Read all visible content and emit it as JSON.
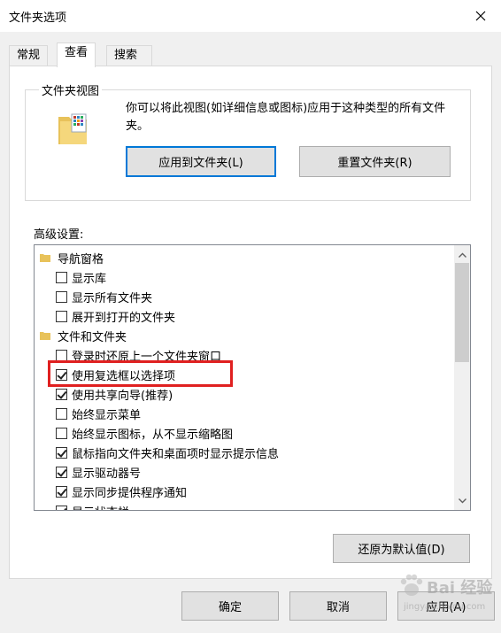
{
  "window": {
    "title": "文件夹选项",
    "close_icon": "close-icon"
  },
  "tabs": [
    {
      "label": "常规",
      "active": false
    },
    {
      "label": "查看",
      "active": true
    },
    {
      "label": "搜索",
      "active": false
    }
  ],
  "folder_views": {
    "legend": "文件夹视图",
    "description": "你可以将此视图(如详细信息或图标)应用于这种类型的所有文件夹。",
    "apply_button": "应用到文件夹(L)",
    "reset_button": "重置文件夹(R)"
  },
  "advanced": {
    "label": "高级设置:",
    "items": [
      {
        "type": "folder",
        "label": "导航窗格"
      },
      {
        "type": "checkbox",
        "label": "显示库",
        "checked": false
      },
      {
        "type": "checkbox",
        "label": "显示所有文件夹",
        "checked": false
      },
      {
        "type": "checkbox",
        "label": "展开到打开的文件夹",
        "checked": false
      },
      {
        "type": "folder",
        "label": "文件和文件夹"
      },
      {
        "type": "checkbox",
        "label": "登录时还原上一个文件夹窗口",
        "checked": false
      },
      {
        "type": "checkbox",
        "label": "使用复选框以选择项",
        "checked": true
      },
      {
        "type": "checkbox",
        "label": "使用共享向导(推荐)",
        "checked": true
      },
      {
        "type": "checkbox",
        "label": "始终显示菜单",
        "checked": false
      },
      {
        "type": "checkbox",
        "label": "始终显示图标，从不显示缩略图",
        "checked": false
      },
      {
        "type": "checkbox",
        "label": "鼠标指向文件夹和桌面项时显示提示信息",
        "checked": true
      },
      {
        "type": "checkbox",
        "label": "显示驱动器号",
        "checked": true
      },
      {
        "type": "checkbox",
        "label": "显示同步提供程序通知",
        "checked": true
      },
      {
        "type": "checkbox",
        "label": "显示状态栏",
        "checked": true
      }
    ],
    "restore_defaults_button": "还原为默认值(D)"
  },
  "footer": {
    "ok_button": "确定",
    "cancel_button": "取消",
    "apply_button": "应用(A)"
  },
  "watermark": {
    "text": "Bai 经验",
    "sub": "jingyan.baidu.com"
  },
  "colors": {
    "highlight": "#e02020",
    "default_button_border": "#0078d7",
    "folder": "#e8c25a"
  }
}
